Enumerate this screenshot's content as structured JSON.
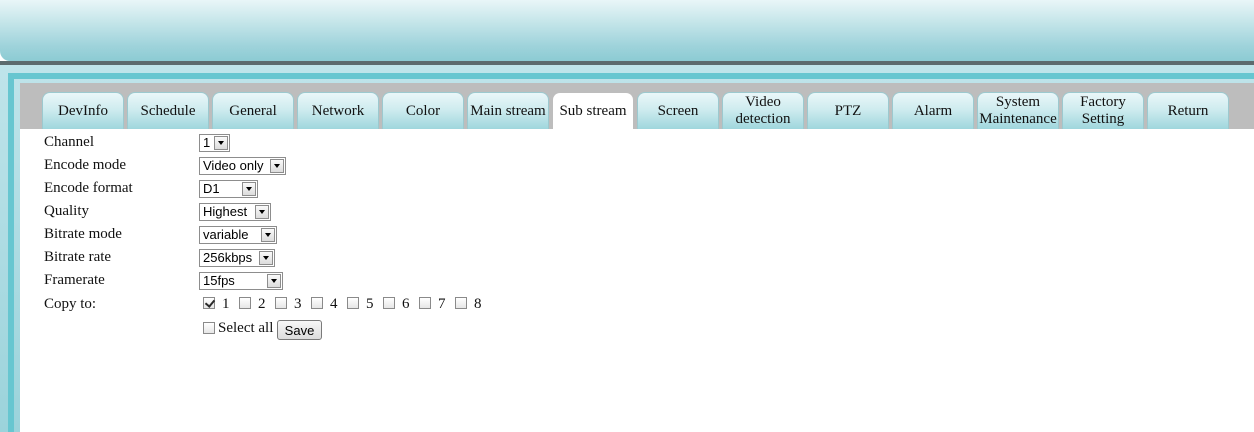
{
  "tabs": [
    {
      "label": "DevInfo"
    },
    {
      "label": "Schedule"
    },
    {
      "label": "General"
    },
    {
      "label": "Network"
    },
    {
      "label": "Color"
    },
    {
      "label": "Main stream"
    },
    {
      "label": "Sub stream",
      "active": true
    },
    {
      "label": "Screen"
    },
    {
      "label": "Video detection"
    },
    {
      "label": "PTZ"
    },
    {
      "label": "Alarm"
    },
    {
      "label": "System Maintenance"
    },
    {
      "label": "Factory Setting"
    },
    {
      "label": "Return"
    }
  ],
  "form": {
    "channel": {
      "label": "Channel",
      "value": "1"
    },
    "encode_mode": {
      "label": "Encode mode",
      "value": "Video only"
    },
    "encode_format": {
      "label": "Encode format",
      "value": "D1"
    },
    "quality": {
      "label": "Quality",
      "value": "Highest"
    },
    "bitrate_mode": {
      "label": "Bitrate mode",
      "value": "variable"
    },
    "bitrate_rate": {
      "label": "Bitrate rate",
      "value": "256kbps"
    },
    "framerate": {
      "label": "Framerate",
      "value": "15fps"
    },
    "copy_to": {
      "label": "Copy to:",
      "channels": [
        {
          "label": "1",
          "checked": true
        },
        {
          "label": "2",
          "checked": false
        },
        {
          "label": "3",
          "checked": false
        },
        {
          "label": "4",
          "checked": false
        },
        {
          "label": "5",
          "checked": false
        },
        {
          "label": "6",
          "checked": false
        },
        {
          "label": "7",
          "checked": false
        },
        {
          "label": "8",
          "checked": false
        }
      ]
    },
    "select_all_label": "Select all",
    "select_all_checked": false,
    "save_label": "Save"
  },
  "colors": {
    "tab_gradient_top": "#eaf7f9",
    "tab_gradient_bottom": "#9fd6dd",
    "frame_accent": "#67c6d0",
    "tabbar_bg": "#bdbdbd"
  }
}
